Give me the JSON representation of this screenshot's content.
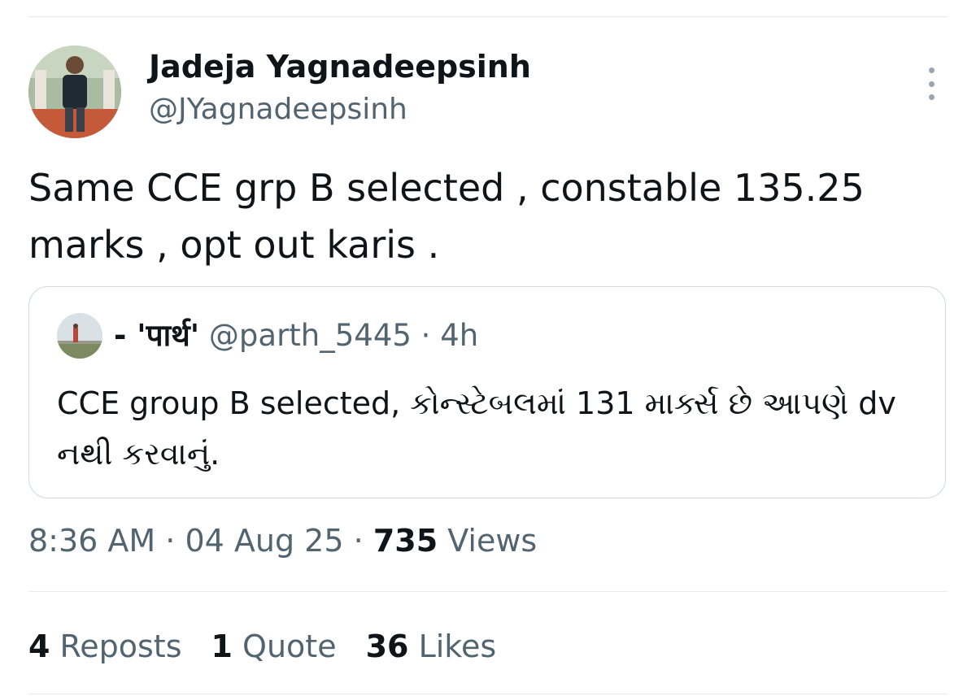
{
  "tweet": {
    "author_name": "Jadeja Yagnadeepsinh",
    "author_handle": "@JYagnadeepsinh",
    "text": "Same CCE grp B selected , constable 135.25 marks , opt out karis .",
    "timestamp": "8:36 AM",
    "date": "04 Aug 25",
    "views_count": "735",
    "views_label": "Views",
    "more_icon": "more-vertical-icon"
  },
  "quote": {
    "author_name": "- 'पार्थ'",
    "author_handle": "@parth_5445",
    "separator": "·",
    "time": "4h",
    "text": "CCE group B selected, કોન્સ્ટેબલમાં 131 માર્ક્સ છે આપણે dv નથી કરવાનું."
  },
  "stats": {
    "reposts_count": "4",
    "reposts_label": "Reposts",
    "quotes_count": "1",
    "quotes_label": "Quote",
    "likes_count": "36",
    "likes_label": "Likes"
  },
  "colors": {
    "text_primary": "#0f1419",
    "text_secondary": "#536471",
    "border": "#cfd9de",
    "divider": "#e6e9ec"
  }
}
